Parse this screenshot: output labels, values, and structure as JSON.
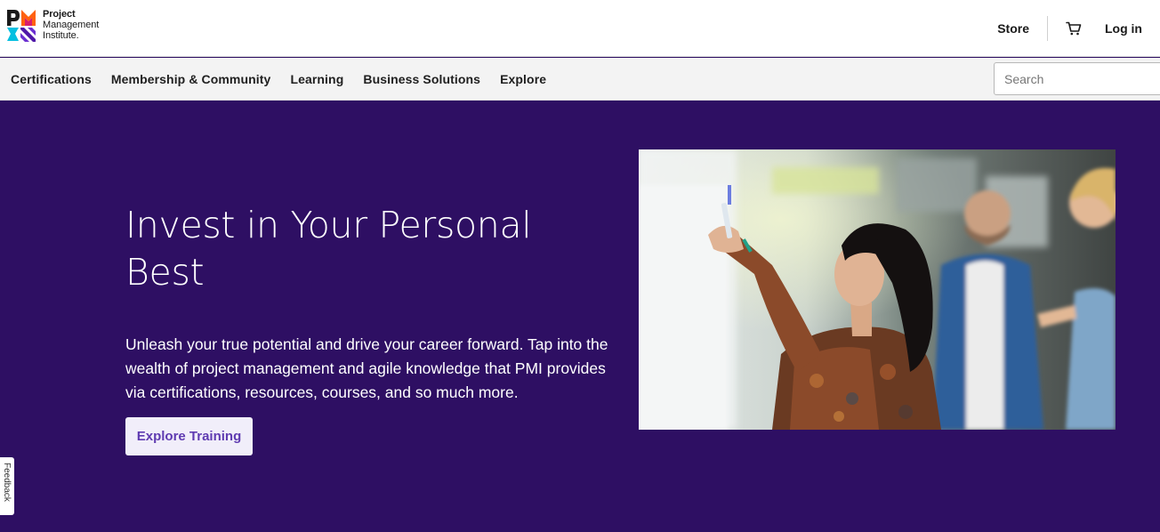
{
  "header": {
    "logo": {
      "line1": "Project",
      "line2": "Management",
      "line3": "Institute."
    },
    "store_label": "Store",
    "cart_icon": "shopping-cart-icon",
    "login_label": "Log in"
  },
  "nav": {
    "items": [
      {
        "label": "Certifications"
      },
      {
        "label": "Membership & Community"
      },
      {
        "label": "Learning"
      },
      {
        "label": "Business Solutions"
      },
      {
        "label": "Explore"
      }
    ],
    "search_placeholder": "Search"
  },
  "hero": {
    "title": "Invest in Your Personal Best",
    "body": "Unleash your true potential and drive your career forward. Tap into the wealth of project management and agile knowledge that PMI provides via certifications, resources, courses, and so much more.",
    "cta_label": "Explore Training",
    "background_color": "#2e0f63"
  },
  "feedback_label": "Feedback",
  "colors": {
    "brand_purple": "#2e0f63",
    "cta_text": "#5f3bb1",
    "logo_orange": "#ff610f",
    "logo_teal": "#05bfe0",
    "logo_purple": "#4f17a8"
  }
}
